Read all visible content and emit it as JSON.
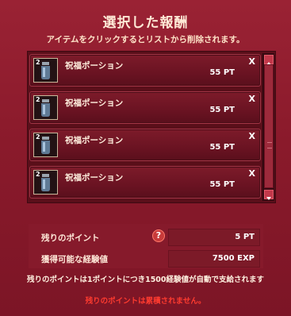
{
  "title": "選択した報酬",
  "subtitle": "アイテムをクリックするとリストから削除されます。",
  "rewards": [
    {
      "count": "2",
      "name": "祝福ポーション",
      "points": "55 PT",
      "remove": "X",
      "icon": "potion-bottle-icon"
    },
    {
      "count": "2",
      "name": "祝福ポーション",
      "points": "55 PT",
      "remove": "X",
      "icon": "potion-bottle-icon"
    },
    {
      "count": "2",
      "name": "祝福ポーション",
      "points": "55 PT",
      "remove": "X",
      "icon": "potion-bottle-icon"
    },
    {
      "count": "2",
      "name": "祝福ポーション",
      "points": "55 PT",
      "remove": "X",
      "icon": "potion-bottle-icon"
    }
  ],
  "stats": {
    "remaining_label": "残りのポイント",
    "remaining_value": "5 PT",
    "help_icon": "?",
    "exp_label": "獲得可能な経験値",
    "exp_value": "7500 EXP"
  },
  "note": "残りのポイントは1ポイントにつき1500経験値が自動で支給されます",
  "warning": "残りのポイントは累積されません。",
  "colors": {
    "panel_bg": "#8a1a2b",
    "item_bg": "#6a1322",
    "warning_text": "#ff3b2f",
    "accent_red": "#c2384a"
  }
}
